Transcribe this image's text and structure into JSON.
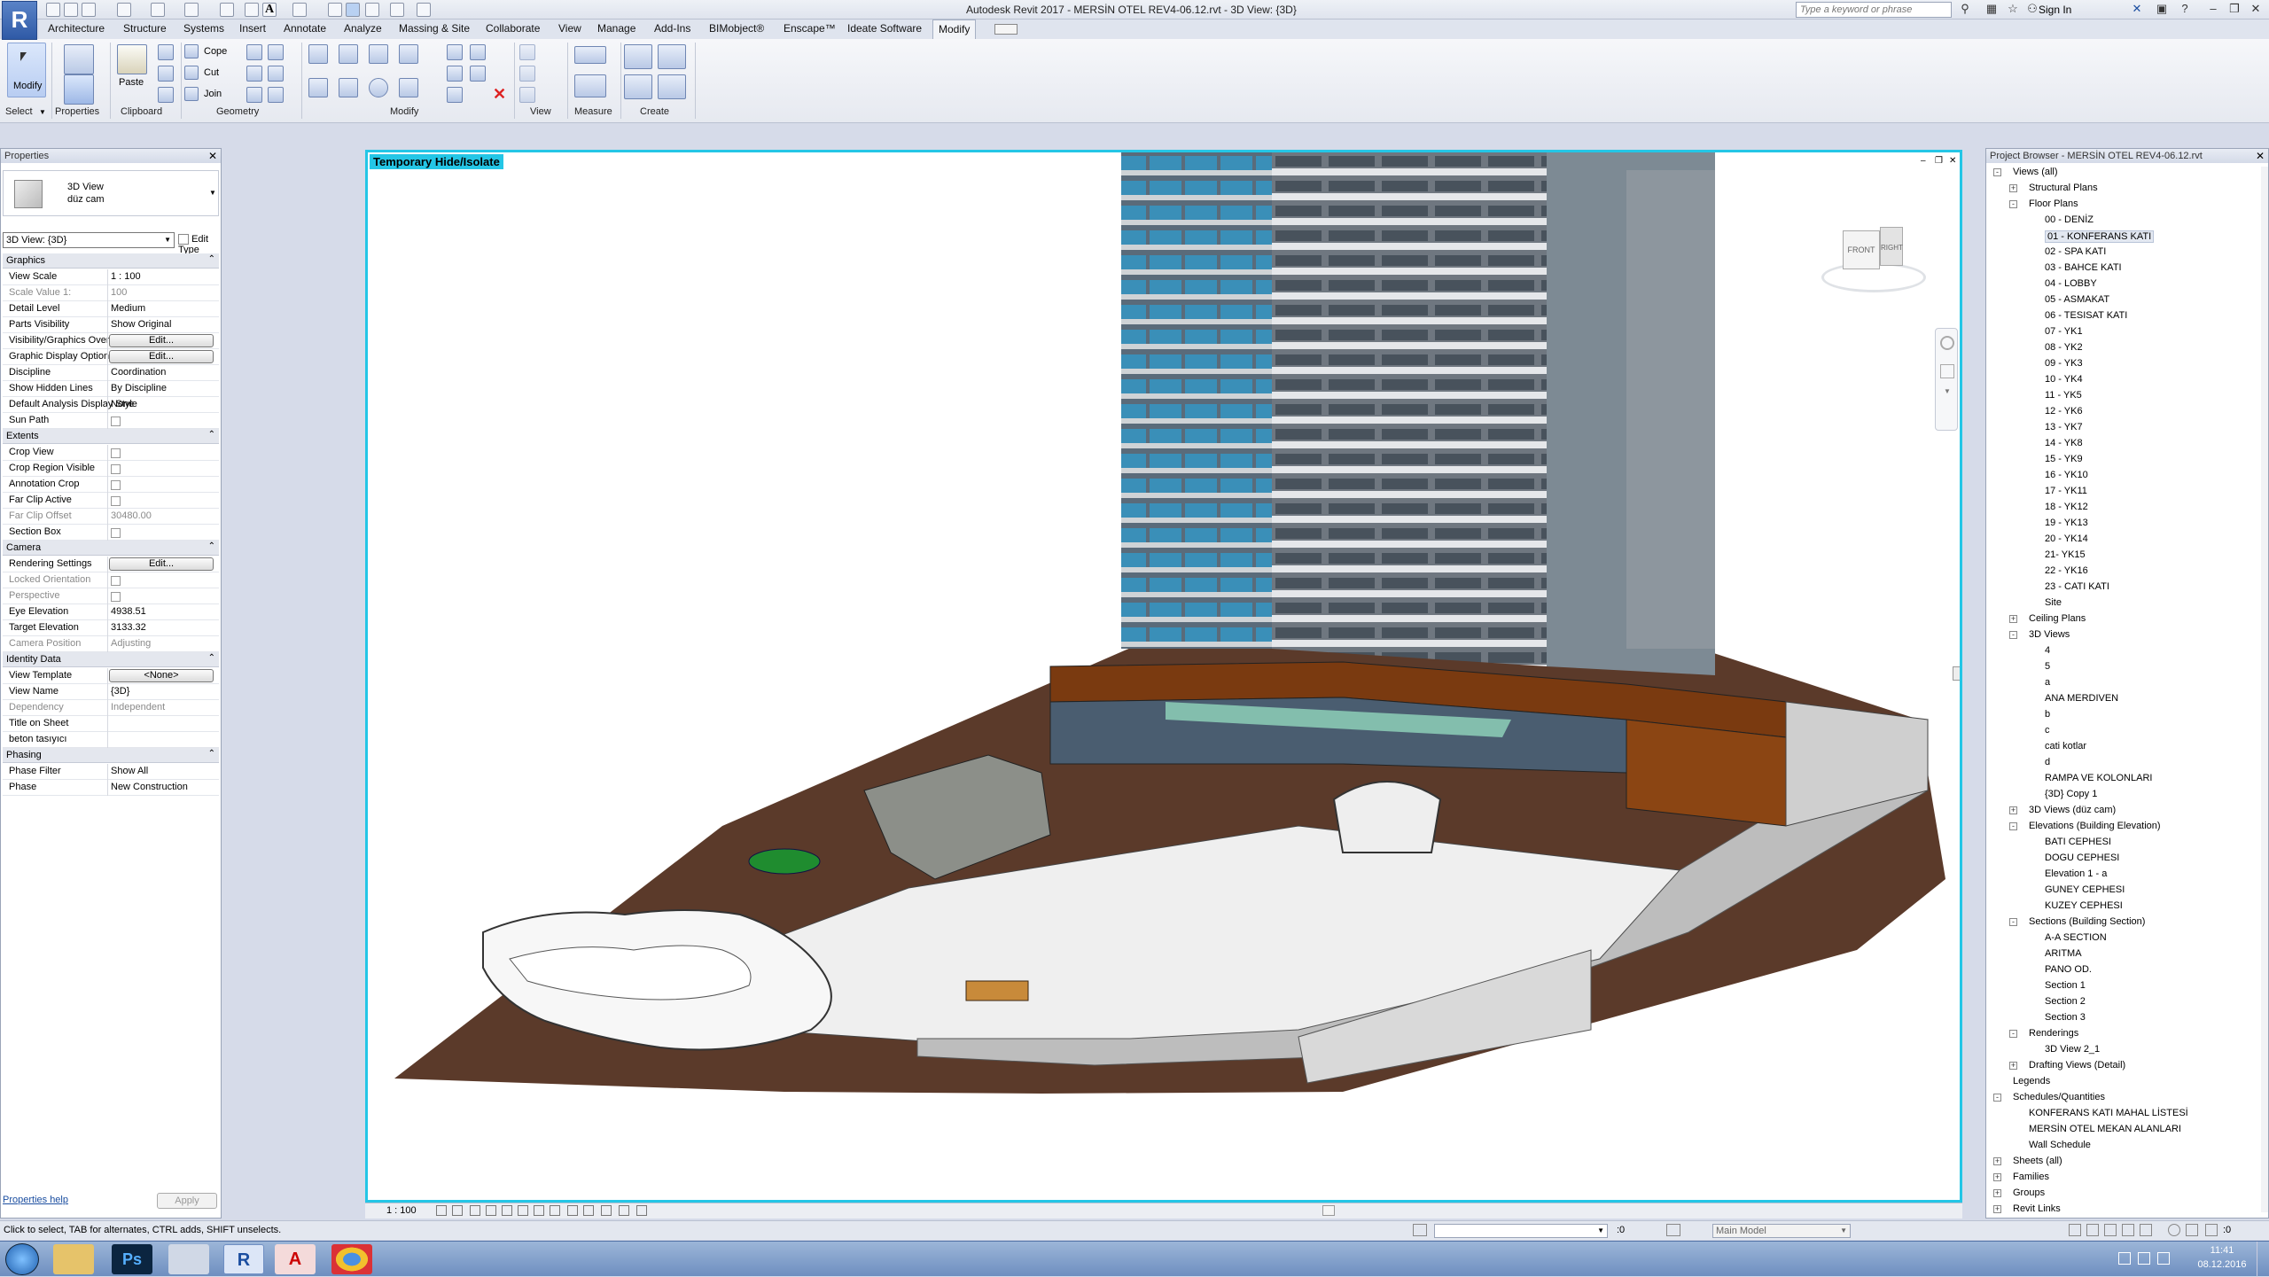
{
  "window": {
    "title": "Autodesk Revit 2017 -    MERSİN OTEL REV4-06.12.rvt - 3D View: {3D}",
    "search_placeholder": "Type a keyword or phrase",
    "sign_in": "Sign In"
  },
  "menu_tabs": [
    "Architecture",
    "Structure",
    "Systems",
    "Insert",
    "Annotate",
    "Analyze",
    "Massing & Site",
    "Collaborate",
    "View",
    "Manage",
    "Add-Ins",
    "BIMobject®",
    "Enscape™",
    "Ideate Software",
    "Modify"
  ],
  "active_tab": "Modify",
  "ribbon": {
    "modify": "Modify",
    "paste": "Paste",
    "cope": "Cope",
    "cut": "Cut",
    "join": "Join",
    "panels": [
      "Select",
      "Properties",
      "Clipboard",
      "Geometry",
      "Modify",
      "View",
      "Measure",
      "Create"
    ]
  },
  "properties": {
    "title": "Properties",
    "type_name": "3D View",
    "type_sub": "düz cam",
    "selector": "3D View: {3D}",
    "edit_type": "Edit Type",
    "groups": [
      {
        "label": "Graphics",
        "rows": [
          {
            "k": "View Scale",
            "v": "1 : 100"
          },
          {
            "k": "Scale Value    1:",
            "v": "100",
            "dim": true
          },
          {
            "k": "Detail Level",
            "v": "Medium"
          },
          {
            "k": "Parts Visibility",
            "v": "Show Original"
          },
          {
            "k": "Visibility/Graphics Overrides",
            "btn": "Edit..."
          },
          {
            "k": "Graphic Display Options",
            "btn": "Edit..."
          },
          {
            "k": "Discipline",
            "v": "Coordination"
          },
          {
            "k": "Show Hidden Lines",
            "v": "By Discipline"
          },
          {
            "k": "Default Analysis Display Style",
            "v": "None"
          },
          {
            "k": "Sun Path",
            "cb": true
          }
        ]
      },
      {
        "label": "Extents",
        "rows": [
          {
            "k": "Crop View",
            "cb": true
          },
          {
            "k": "Crop Region Visible",
            "cb": true
          },
          {
            "k": "Annotation Crop",
            "cb": true
          },
          {
            "k": "Far Clip Active",
            "cb": true
          },
          {
            "k": "Far Clip Offset",
            "v": "30480.00",
            "dim": true
          },
          {
            "k": "Section Box",
            "cb": true
          }
        ]
      },
      {
        "label": "Camera",
        "rows": [
          {
            "k": "Rendering Settings",
            "btn": "Edit..."
          },
          {
            "k": "Locked Orientation",
            "cb": true,
            "dim": true
          },
          {
            "k": "Perspective",
            "cb": true,
            "dim": true
          },
          {
            "k": "Eye Elevation",
            "v": "4938.51"
          },
          {
            "k": "Target Elevation",
            "v": "3133.32"
          },
          {
            "k": "Camera Position",
            "v": "Adjusting",
            "dim": true
          }
        ]
      },
      {
        "label": "Identity Data",
        "rows": [
          {
            "k": "View Template",
            "btn": "<None>"
          },
          {
            "k": "View Name",
            "v": "{3D}"
          },
          {
            "k": "Dependency",
            "v": "Independent",
            "dim": true
          },
          {
            "k": "Title on Sheet",
            "v": ""
          },
          {
            "k": "beton tasıyıcı",
            "v": ""
          }
        ]
      },
      {
        "label": "Phasing",
        "rows": [
          {
            "k": "Phase Filter",
            "v": "Show All"
          },
          {
            "k": "Phase",
            "v": "New Construction"
          }
        ]
      }
    ],
    "help": "Properties help",
    "apply": "Apply"
  },
  "viewport": {
    "banner": "Temporary Hide/Isolate",
    "viewcube_front": "FRONT",
    "viewcube_right": "RIGHT"
  },
  "view_bar": {
    "scale": "1 : 100"
  },
  "browser": {
    "title": "Project Browser - MERSİN OTEL REV4-06.12.rvt",
    "rows": [
      {
        "t": "Views (all)",
        "d": 0,
        "tg": "-"
      },
      {
        "t": "Structural Plans",
        "d": 1,
        "tg": "+"
      },
      {
        "t": "Floor Plans",
        "d": 1,
        "tg": "-"
      },
      {
        "t": "00 - DENİZ",
        "d": 2
      },
      {
        "t": "01 - KONFERANS KATI",
        "d": 2,
        "sel": true
      },
      {
        "t": "02 - SPA KATI",
        "d": 2
      },
      {
        "t": "03 - BAHCE  KATI",
        "d": 2
      },
      {
        "t": "04 - LOBBY",
        "d": 2
      },
      {
        "t": "05 - ASMAKAT",
        "d": 2
      },
      {
        "t": "06 - TESISAT KATI",
        "d": 2
      },
      {
        "t": "07 - YK1",
        "d": 2
      },
      {
        "t": "08 - YK2",
        "d": 2
      },
      {
        "t": "09 - YK3",
        "d": 2
      },
      {
        "t": "10 - YK4",
        "d": 2
      },
      {
        "t": "11 - YK5",
        "d": 2
      },
      {
        "t": "12 - YK6",
        "d": 2
      },
      {
        "t": "13 - YK7",
        "d": 2
      },
      {
        "t": "14 - YK8",
        "d": 2
      },
      {
        "t": "15 - YK9",
        "d": 2
      },
      {
        "t": "16 - YK10",
        "d": 2
      },
      {
        "t": "17 - YK11",
        "d": 2
      },
      {
        "t": "18 - YK12",
        "d": 2
      },
      {
        "t": "19 - YK13",
        "d": 2
      },
      {
        "t": "20 - YK14",
        "d": 2
      },
      {
        "t": "21- YK15",
        "d": 2
      },
      {
        "t": "22 - YK16",
        "d": 2
      },
      {
        "t": "23 - CATI KATI",
        "d": 2
      },
      {
        "t": "Site",
        "d": 2
      },
      {
        "t": "Ceiling Plans",
        "d": 1,
        "tg": "+"
      },
      {
        "t": "3D Views",
        "d": 1,
        "tg": "-"
      },
      {
        "t": "4",
        "d": 2
      },
      {
        "t": "5",
        "d": 2
      },
      {
        "t": "a",
        "d": 2
      },
      {
        "t": "ANA MERDIVEN",
        "d": 2
      },
      {
        "t": "b",
        "d": 2
      },
      {
        "t": "c",
        "d": 2
      },
      {
        "t": "cati kotlar",
        "d": 2
      },
      {
        "t": "d",
        "d": 2
      },
      {
        "t": "RAMPA VE KOLONLARI",
        "d": 2
      },
      {
        "t": "{3D} Copy 1",
        "d": 2
      },
      {
        "t": "3D Views (düz cam)",
        "d": 1,
        "tg": "+"
      },
      {
        "t": "Elevations (Building Elevation)",
        "d": 1,
        "tg": "-"
      },
      {
        "t": "BATI CEPHESI",
        "d": 2
      },
      {
        "t": "DOGU CEPHESI",
        "d": 2
      },
      {
        "t": "Elevation 1 - a",
        "d": 2
      },
      {
        "t": "GUNEY CEPHESI",
        "d": 2
      },
      {
        "t": "KUZEY CEPHESI",
        "d": 2
      },
      {
        "t": "Sections (Building Section)",
        "d": 1,
        "tg": "-"
      },
      {
        "t": "A-A SECTION",
        "d": 2
      },
      {
        "t": "ARITMA",
        "d": 2
      },
      {
        "t": "PANO OD.",
        "d": 2
      },
      {
        "t": "Section 1",
        "d": 2
      },
      {
        "t": "Section 2",
        "d": 2
      },
      {
        "t": "Section 3",
        "d": 2
      },
      {
        "t": "Renderings",
        "d": 1,
        "tg": "-"
      },
      {
        "t": "3D View 2_1",
        "d": 2
      },
      {
        "t": "Drafting Views (Detail)",
        "d": 1,
        "tg": "+"
      },
      {
        "t": "Legends",
        "d": 0
      },
      {
        "t": "Schedules/Quantities",
        "d": 0,
        "tg": "-"
      },
      {
        "t": "KONFERANS KATI MAHAL LİSTESİ",
        "d": 1
      },
      {
        "t": "MERSİN OTEL MEKAN ALANLARI",
        "d": 1
      },
      {
        "t": "Wall Schedule",
        "d": 1
      },
      {
        "t": "Sheets (all)",
        "d": 0,
        "tg": "+"
      },
      {
        "t": "Families",
        "d": 0,
        "tg": "+"
      },
      {
        "t": "Groups",
        "d": 0,
        "tg": "+"
      },
      {
        "t": "Revit Links",
        "d": 0,
        "tg": "+"
      }
    ]
  },
  "status": {
    "hint": "Click to select, TAB for alternates, CTRL adds, SHIFT unselects.",
    "worksets": ":0",
    "model": "Main Model",
    "filter": ":0"
  },
  "taskbar": {
    "time": "11:41",
    "date": "08.12.2016"
  }
}
